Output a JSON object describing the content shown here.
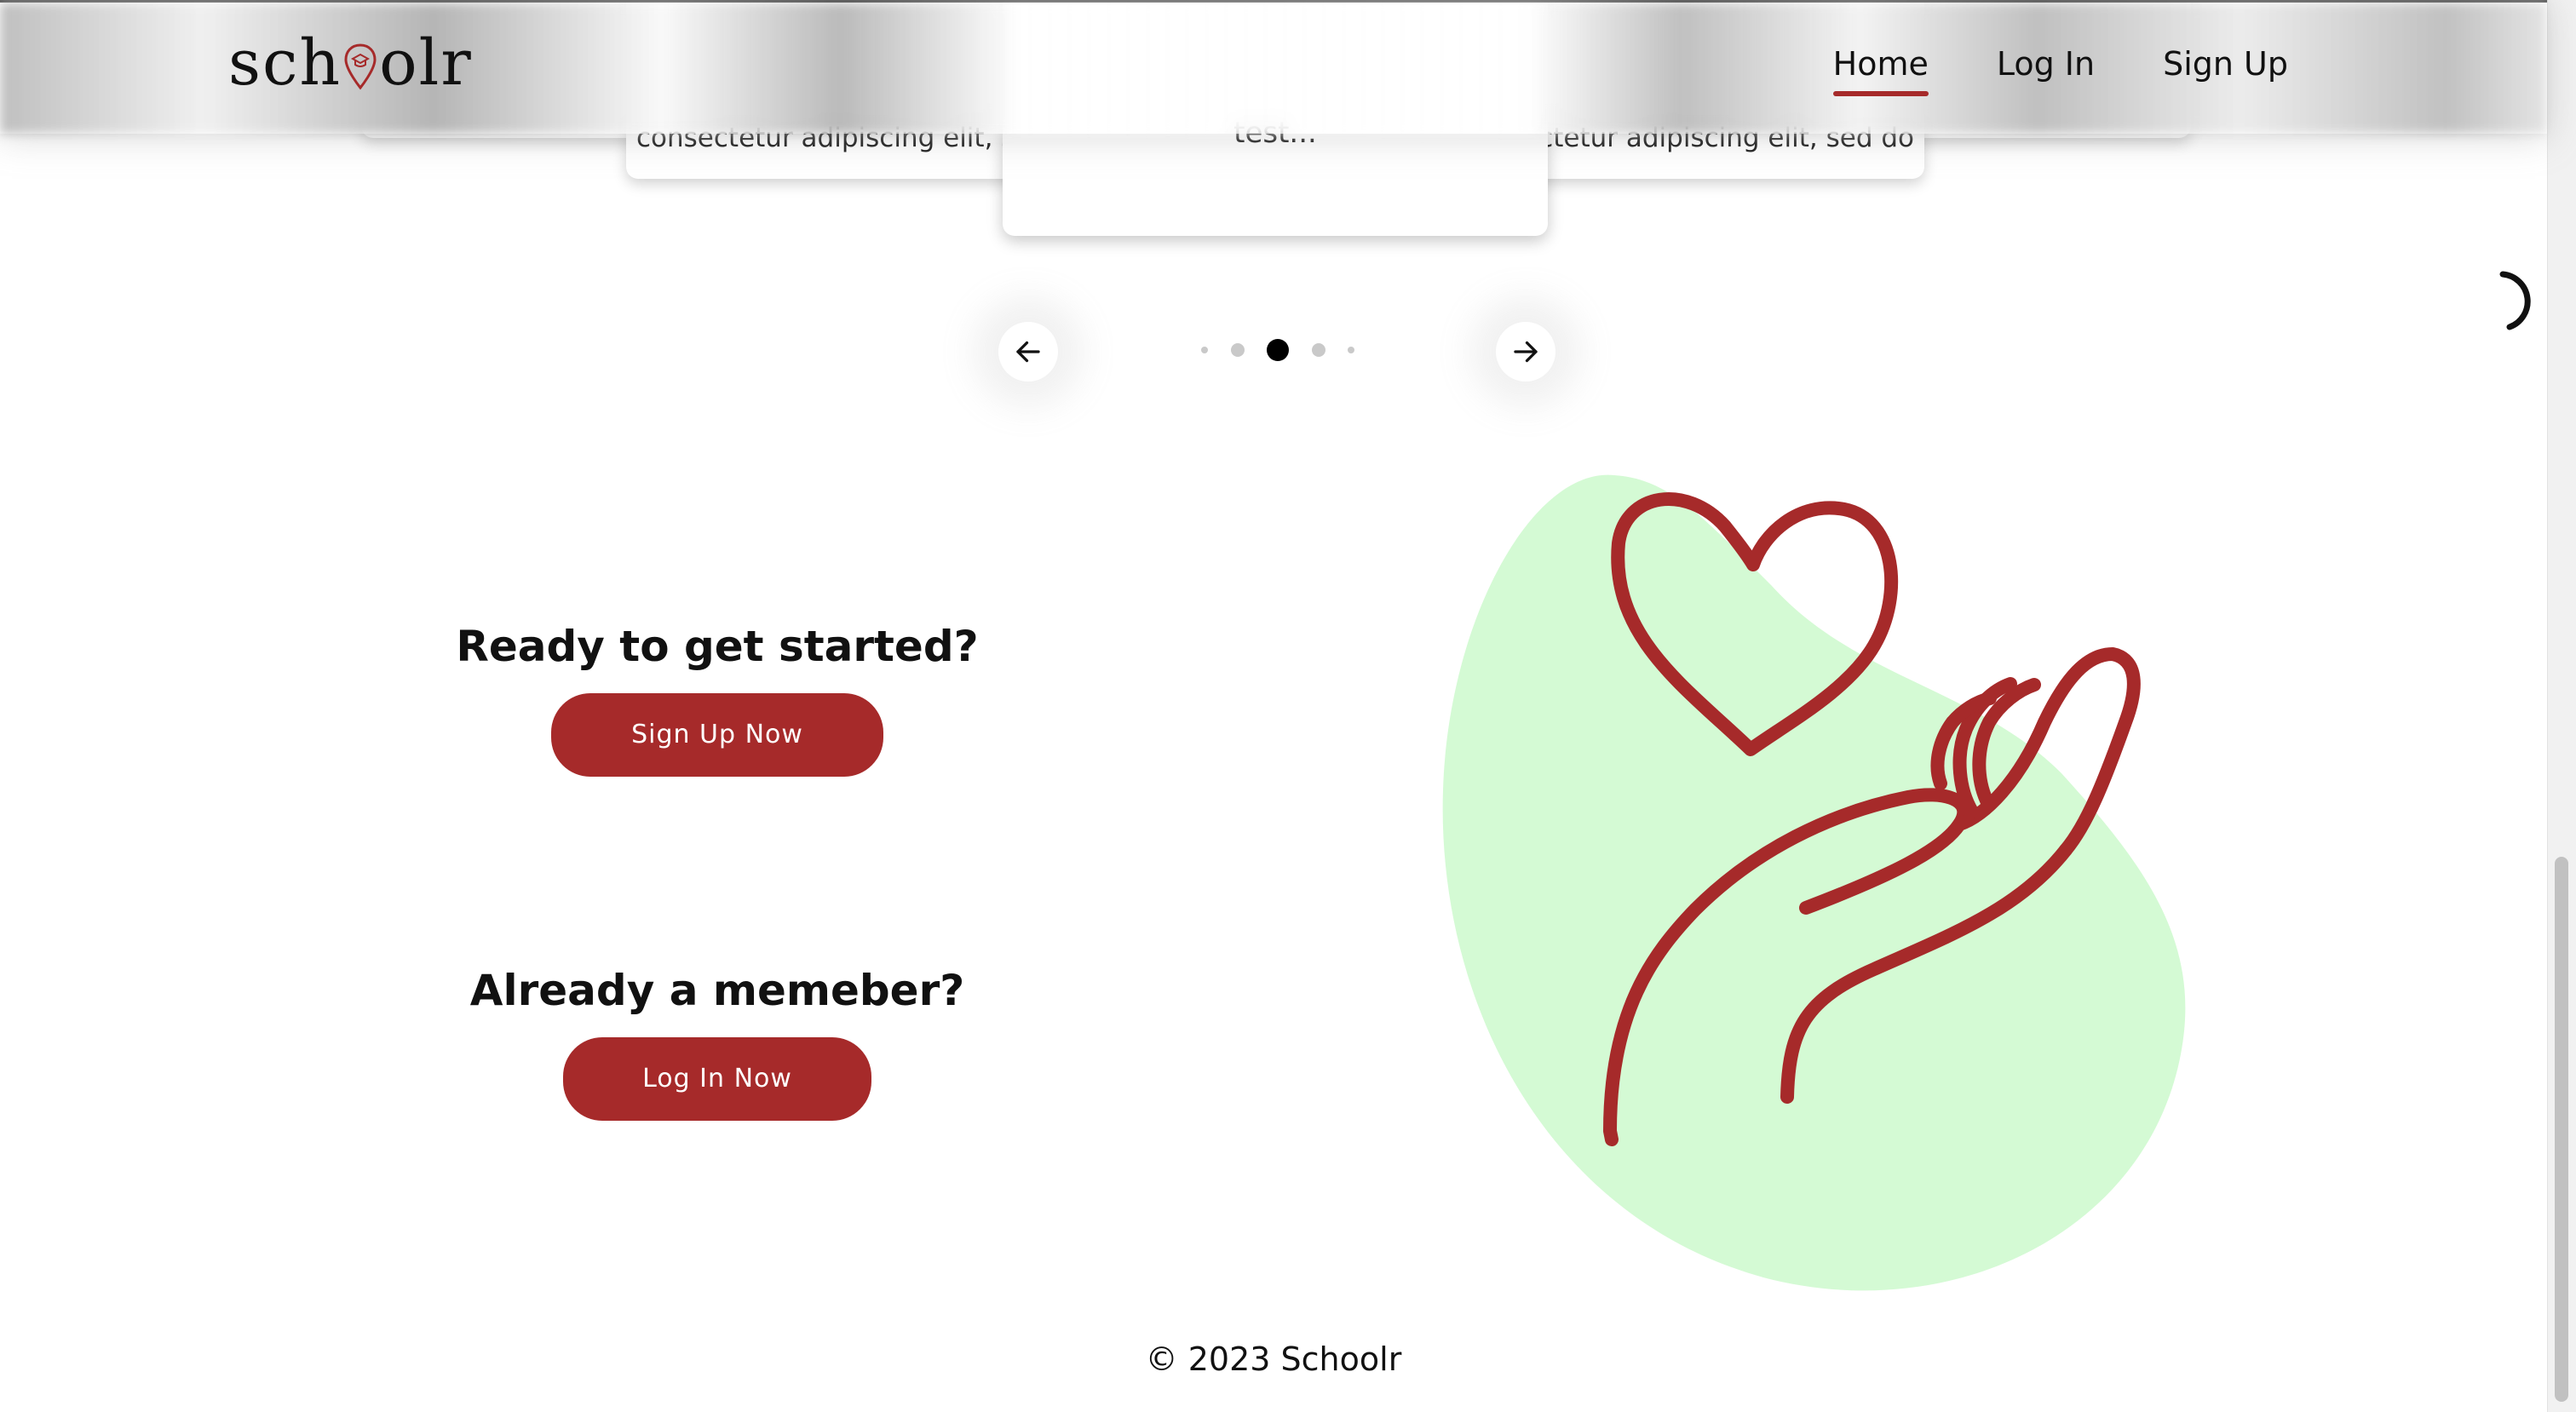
{
  "header": {
    "logo_text_before": "sch",
    "logo_text_after": "olr",
    "nav": [
      {
        "label": "Home",
        "active": true
      },
      {
        "label": "Log In",
        "active": false
      },
      {
        "label": "Sign Up",
        "active": false
      }
    ],
    "accent_color": "#a62a2a"
  },
  "carousel": {
    "left_card_snippet": "consectetur adipiscing elit, se",
    "right_card_snippet": "ectetur adipiscing elit, sed do",
    "center_card_snippet": "test...",
    "dot_count": 5,
    "active_dot": 3,
    "prev_icon": "arrow-left-icon",
    "next_icon": "arrow-right-icon"
  },
  "cta": {
    "signup_heading": "Ready to get started?",
    "signup_button": "Sign Up Now",
    "login_heading": "Already a memeber?",
    "login_button": "Log In Now",
    "button_color": "#a62a2a"
  },
  "illustration": {
    "icon": "heart-in-hand-icon",
    "blob_color": "#d4fad4",
    "stroke_color": "#a62a2a"
  },
  "footer": {
    "copyright": "© 2023 Schoolr"
  }
}
